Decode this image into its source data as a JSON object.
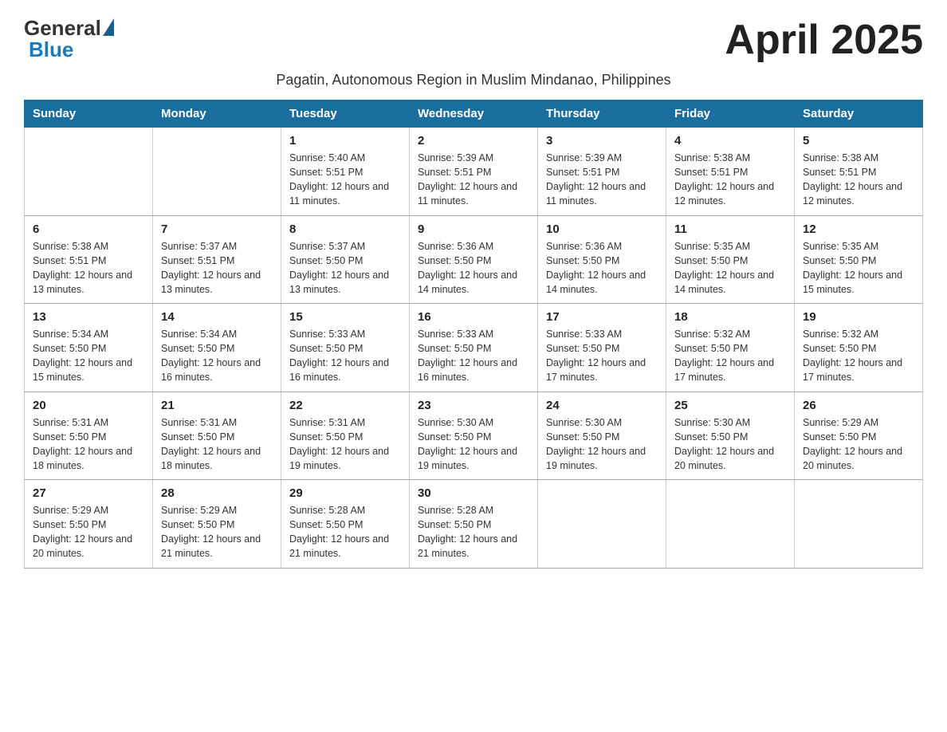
{
  "header": {
    "logo_general": "General",
    "logo_blue": "Blue",
    "title": "April 2025",
    "subtitle": "Pagatin, Autonomous Region in Muslim Mindanao, Philippines"
  },
  "columns": [
    "Sunday",
    "Monday",
    "Tuesday",
    "Wednesday",
    "Thursday",
    "Friday",
    "Saturday"
  ],
  "weeks": [
    [
      {
        "day": "",
        "sunrise": "",
        "sunset": "",
        "daylight": ""
      },
      {
        "day": "",
        "sunrise": "",
        "sunset": "",
        "daylight": ""
      },
      {
        "day": "1",
        "sunrise": "Sunrise: 5:40 AM",
        "sunset": "Sunset: 5:51 PM",
        "daylight": "Daylight: 12 hours and 11 minutes."
      },
      {
        "day": "2",
        "sunrise": "Sunrise: 5:39 AM",
        "sunset": "Sunset: 5:51 PM",
        "daylight": "Daylight: 12 hours and 11 minutes."
      },
      {
        "day": "3",
        "sunrise": "Sunrise: 5:39 AM",
        "sunset": "Sunset: 5:51 PM",
        "daylight": "Daylight: 12 hours and 11 minutes."
      },
      {
        "day": "4",
        "sunrise": "Sunrise: 5:38 AM",
        "sunset": "Sunset: 5:51 PM",
        "daylight": "Daylight: 12 hours and 12 minutes."
      },
      {
        "day": "5",
        "sunrise": "Sunrise: 5:38 AM",
        "sunset": "Sunset: 5:51 PM",
        "daylight": "Daylight: 12 hours and 12 minutes."
      }
    ],
    [
      {
        "day": "6",
        "sunrise": "Sunrise: 5:38 AM",
        "sunset": "Sunset: 5:51 PM",
        "daylight": "Daylight: 12 hours and 13 minutes."
      },
      {
        "day": "7",
        "sunrise": "Sunrise: 5:37 AM",
        "sunset": "Sunset: 5:51 PM",
        "daylight": "Daylight: 12 hours and 13 minutes."
      },
      {
        "day": "8",
        "sunrise": "Sunrise: 5:37 AM",
        "sunset": "Sunset: 5:50 PM",
        "daylight": "Daylight: 12 hours and 13 minutes."
      },
      {
        "day": "9",
        "sunrise": "Sunrise: 5:36 AM",
        "sunset": "Sunset: 5:50 PM",
        "daylight": "Daylight: 12 hours and 14 minutes."
      },
      {
        "day": "10",
        "sunrise": "Sunrise: 5:36 AM",
        "sunset": "Sunset: 5:50 PM",
        "daylight": "Daylight: 12 hours and 14 minutes."
      },
      {
        "day": "11",
        "sunrise": "Sunrise: 5:35 AM",
        "sunset": "Sunset: 5:50 PM",
        "daylight": "Daylight: 12 hours and 14 minutes."
      },
      {
        "day": "12",
        "sunrise": "Sunrise: 5:35 AM",
        "sunset": "Sunset: 5:50 PM",
        "daylight": "Daylight: 12 hours and 15 minutes."
      }
    ],
    [
      {
        "day": "13",
        "sunrise": "Sunrise: 5:34 AM",
        "sunset": "Sunset: 5:50 PM",
        "daylight": "Daylight: 12 hours and 15 minutes."
      },
      {
        "day": "14",
        "sunrise": "Sunrise: 5:34 AM",
        "sunset": "Sunset: 5:50 PM",
        "daylight": "Daylight: 12 hours and 16 minutes."
      },
      {
        "day": "15",
        "sunrise": "Sunrise: 5:33 AM",
        "sunset": "Sunset: 5:50 PM",
        "daylight": "Daylight: 12 hours and 16 minutes."
      },
      {
        "day": "16",
        "sunrise": "Sunrise: 5:33 AM",
        "sunset": "Sunset: 5:50 PM",
        "daylight": "Daylight: 12 hours and 16 minutes."
      },
      {
        "day": "17",
        "sunrise": "Sunrise: 5:33 AM",
        "sunset": "Sunset: 5:50 PM",
        "daylight": "Daylight: 12 hours and 17 minutes."
      },
      {
        "day": "18",
        "sunrise": "Sunrise: 5:32 AM",
        "sunset": "Sunset: 5:50 PM",
        "daylight": "Daylight: 12 hours and 17 minutes."
      },
      {
        "day": "19",
        "sunrise": "Sunrise: 5:32 AM",
        "sunset": "Sunset: 5:50 PM",
        "daylight": "Daylight: 12 hours and 17 minutes."
      }
    ],
    [
      {
        "day": "20",
        "sunrise": "Sunrise: 5:31 AM",
        "sunset": "Sunset: 5:50 PM",
        "daylight": "Daylight: 12 hours and 18 minutes."
      },
      {
        "day": "21",
        "sunrise": "Sunrise: 5:31 AM",
        "sunset": "Sunset: 5:50 PM",
        "daylight": "Daylight: 12 hours and 18 minutes."
      },
      {
        "day": "22",
        "sunrise": "Sunrise: 5:31 AM",
        "sunset": "Sunset: 5:50 PM",
        "daylight": "Daylight: 12 hours and 19 minutes."
      },
      {
        "day": "23",
        "sunrise": "Sunrise: 5:30 AM",
        "sunset": "Sunset: 5:50 PM",
        "daylight": "Daylight: 12 hours and 19 minutes."
      },
      {
        "day": "24",
        "sunrise": "Sunrise: 5:30 AM",
        "sunset": "Sunset: 5:50 PM",
        "daylight": "Daylight: 12 hours and 19 minutes."
      },
      {
        "day": "25",
        "sunrise": "Sunrise: 5:30 AM",
        "sunset": "Sunset: 5:50 PM",
        "daylight": "Daylight: 12 hours and 20 minutes."
      },
      {
        "day": "26",
        "sunrise": "Sunrise: 5:29 AM",
        "sunset": "Sunset: 5:50 PM",
        "daylight": "Daylight: 12 hours and 20 minutes."
      }
    ],
    [
      {
        "day": "27",
        "sunrise": "Sunrise: 5:29 AM",
        "sunset": "Sunset: 5:50 PM",
        "daylight": "Daylight: 12 hours and 20 minutes."
      },
      {
        "day": "28",
        "sunrise": "Sunrise: 5:29 AM",
        "sunset": "Sunset: 5:50 PM",
        "daylight": "Daylight: 12 hours and 21 minutes."
      },
      {
        "day": "29",
        "sunrise": "Sunrise: 5:28 AM",
        "sunset": "Sunset: 5:50 PM",
        "daylight": "Daylight: 12 hours and 21 minutes."
      },
      {
        "day": "30",
        "sunrise": "Sunrise: 5:28 AM",
        "sunset": "Sunset: 5:50 PM",
        "daylight": "Daylight: 12 hours and 21 minutes."
      },
      {
        "day": "",
        "sunrise": "",
        "sunset": "",
        "daylight": ""
      },
      {
        "day": "",
        "sunrise": "",
        "sunset": "",
        "daylight": ""
      },
      {
        "day": "",
        "sunrise": "",
        "sunset": "",
        "daylight": ""
      }
    ]
  ]
}
